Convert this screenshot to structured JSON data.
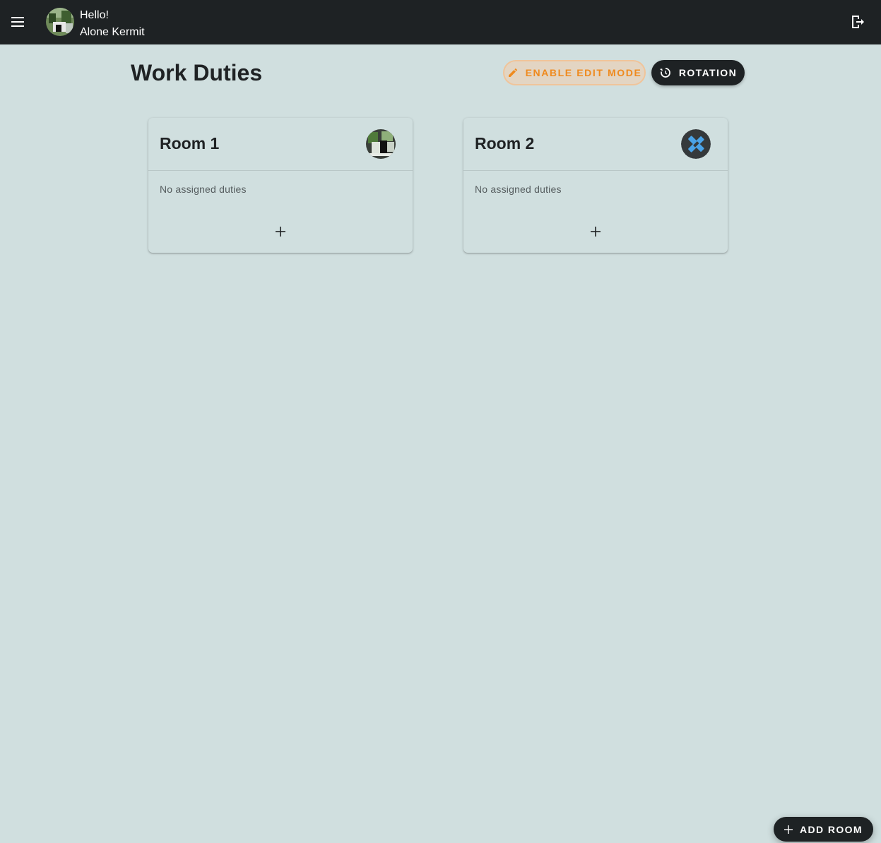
{
  "header": {
    "greeting": "Hello!",
    "user_name": "Alone Kermit",
    "menu_icon": "hamburger-menu-icon",
    "logout_icon": "logout-icon"
  },
  "page": {
    "title": "Work Duties",
    "edit_mode_label": "ENABLE EDIT MODE",
    "rotation_label": "ROTATION"
  },
  "rooms": [
    {
      "name": "Room 1",
      "empty_text": "No assigned duties",
      "avatar": "photo-avatar"
    },
    {
      "name": "Room 2",
      "empty_text": "No assigned duties",
      "avatar": "tool-avatar"
    }
  ],
  "fab": {
    "add_room_label": "ADD ROOM"
  },
  "colors": {
    "topbar": "#1e2224",
    "background": "#d0dfdf",
    "accent_orange": "#ef8a1e",
    "avatar_blue": "#4aa3e8"
  }
}
